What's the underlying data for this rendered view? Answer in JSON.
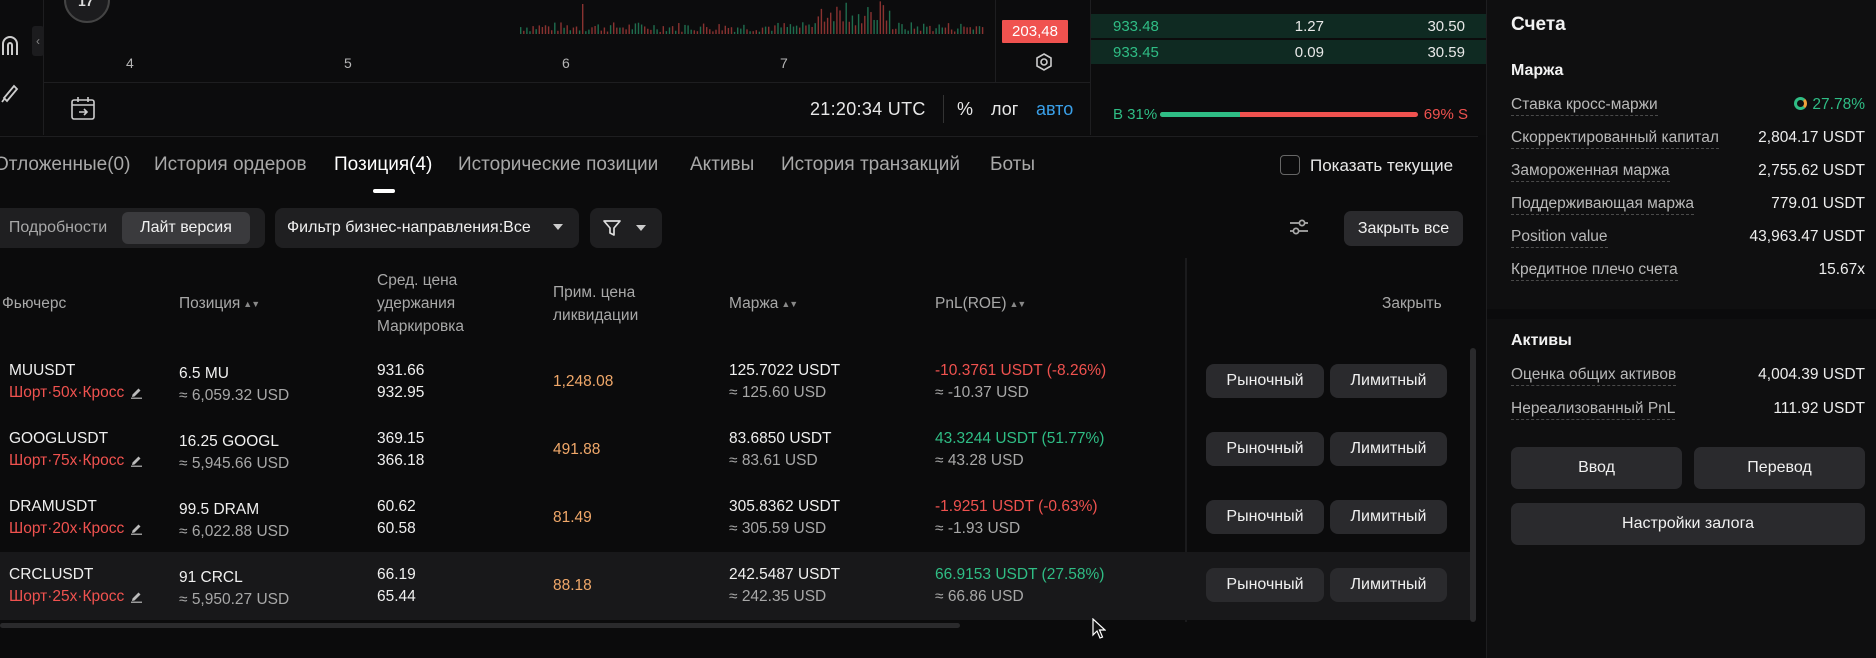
{
  "chart": {
    "x_ticks": [
      "4",
      "5",
      "6",
      "7"
    ],
    "price_tag": "203,48",
    "time": "21:20:34 UTC",
    "options": {
      "percent": "%",
      "log": "лог",
      "auto": "авто"
    }
  },
  "orderbook": {
    "rows": [
      {
        "price": "933.48",
        "qty": "1.27",
        "total": "30.50"
      },
      {
        "price": "933.45",
        "qty": "0.09",
        "total": "30.59"
      }
    ],
    "buy_ratio": "B 31%",
    "sell_ratio": "69% S",
    "buy_fraction": 0.31
  },
  "account": {
    "title": "Счета",
    "margin_section": "Маржа",
    "margin_rows": [
      {
        "label": "Ставка кросс-маржи",
        "value": "27.78%"
      },
      {
        "label": "Скорректированный капитал",
        "value": "2,804.17 USDT"
      },
      {
        "label": "Замороженная маржа",
        "value": "2,755.62 USDT"
      },
      {
        "label": "Поддерживающая маржа",
        "value": "779.01 USDT"
      },
      {
        "label": "Position value",
        "value": "43,963.47 USDT"
      },
      {
        "label": "Кредитное плечо счета",
        "value": "15.67x"
      }
    ],
    "assets_section": "Активы",
    "asset_rows": [
      {
        "label": "Оценка общих активов",
        "value": "4,004.39 USDT"
      },
      {
        "label": "Нереализованный PnL",
        "value": "111.92 USDT"
      }
    ],
    "deposit": "Ввод",
    "transfer": "Перевод",
    "collateral": "Настройки залога"
  },
  "tabs": {
    "items": [
      "Отложенные(0)",
      "История ордеров",
      "Позиция(4)",
      "Исторические позиции",
      "Активы",
      "История транзакций",
      "Боты"
    ],
    "show_current": "Показать текущие"
  },
  "filters": {
    "details": "Подробности",
    "lite": "Лайт версия",
    "business": "Фильтр бизнес-направления:Все",
    "close_all": "Закрыть все"
  },
  "table": {
    "headers": {
      "futures": "Фьючерс",
      "position": "Позиция",
      "avg_price": [
        "Сред. цена",
        "удержания",
        "Маркировка"
      ],
      "liq_price": [
        "Прим. цена",
        "ликвидации"
      ],
      "margin": "Маржа",
      "pnl": "PnL(ROE)",
      "close": "Закрыть"
    },
    "market_label": "Рыночный",
    "limit_label": "Лимитный",
    "rows": [
      {
        "symbol": "MUUSDT",
        "mode": "Шорт·50x·Кросс",
        "qty": "6.5 MU",
        "qty_usd": "≈ 6,059.32 USD",
        "avg": "931.66",
        "mark": "932.95",
        "liq": "1,248.08",
        "margin": "125.7022 USDT",
        "margin_usd": "≈ 125.60 USD",
        "pnl": "-10.3761 USDT (-8.26%)",
        "pnl_usd": "≈ -10.37 USD",
        "pnl_sign": "red"
      },
      {
        "symbol": "GOOGLUSDT",
        "mode": "Шорт·75x·Кросс",
        "qty": "16.25 GOOGL",
        "qty_usd": "≈ 5,945.66 USD",
        "avg": "369.15",
        "mark": "366.18",
        "liq": "491.88",
        "margin": "83.6850 USDT",
        "margin_usd": "≈ 83.61 USD",
        "pnl": "43.3244 USDT (51.77%)",
        "pnl_usd": "≈ 43.28 USD",
        "pnl_sign": "green"
      },
      {
        "symbol": "DRAMUSDT",
        "mode": "Шорт·20x·Кросс",
        "qty": "99.5 DRAM",
        "qty_usd": "≈ 6,022.88 USD",
        "avg": "60.62",
        "mark": "60.58",
        "liq": "81.49",
        "margin": "305.8362 USDT",
        "margin_usd": "≈ 305.59 USD",
        "pnl": "-1.9251 USDT (-0.63%)",
        "pnl_usd": "≈ -1.93 USD",
        "pnl_sign": "red"
      },
      {
        "symbol": "CRCLUSDT",
        "mode": "Шорт·25x·Кросс",
        "qty": "91 CRCL",
        "qty_usd": "≈ 5,950.27 USD",
        "avg": "66.19",
        "mark": "65.44",
        "liq": "88.18",
        "margin": "242.5487 USDT",
        "margin_usd": "≈ 242.35 USD",
        "pnl": "66.9153 USDT (27.58%)",
        "pnl_usd": "≈ 66.86 USD",
        "pnl_sign": "green"
      }
    ]
  },
  "colors": {
    "green": "#2fbd85",
    "red": "#f0524f",
    "orange": "#f0a86a"
  }
}
